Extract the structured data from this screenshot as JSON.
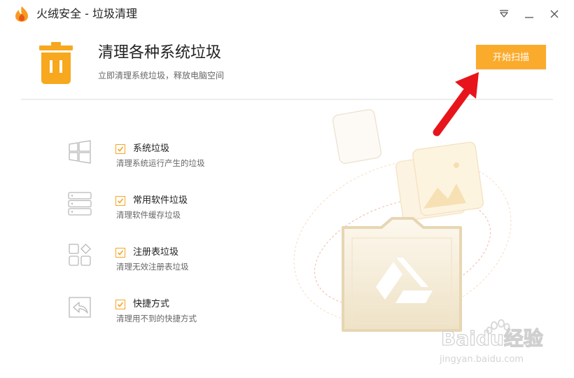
{
  "window": {
    "title": "火绒安全 - 垃圾清理"
  },
  "header": {
    "title": "清理各种系统垃圾",
    "subtitle": "立即清理系统垃圾，释放电脑空间",
    "scan_button": "开始扫描"
  },
  "items": [
    {
      "name": "系统垃圾",
      "desc": "清理系统运行产生的垃圾",
      "checked": true,
      "icon": "windows-icon"
    },
    {
      "name": "常用软件垃圾",
      "desc": "清理软件缓存垃圾",
      "checked": true,
      "icon": "server-stack-icon"
    },
    {
      "name": "注册表垃圾",
      "desc": "清理无效注册表垃圾",
      "checked": true,
      "icon": "registry-grid-icon"
    },
    {
      "name": "快捷方式",
      "desc": "清理用不到的快捷方式",
      "checked": true,
      "icon": "shortcut-icon"
    }
  ],
  "watermark": {
    "brand": "Baidu经验",
    "url": "jingyan.baidu.com"
  },
  "colors": {
    "accent": "#fbab2c",
    "arrow": "#e8141b",
    "check": "#f5a623"
  }
}
